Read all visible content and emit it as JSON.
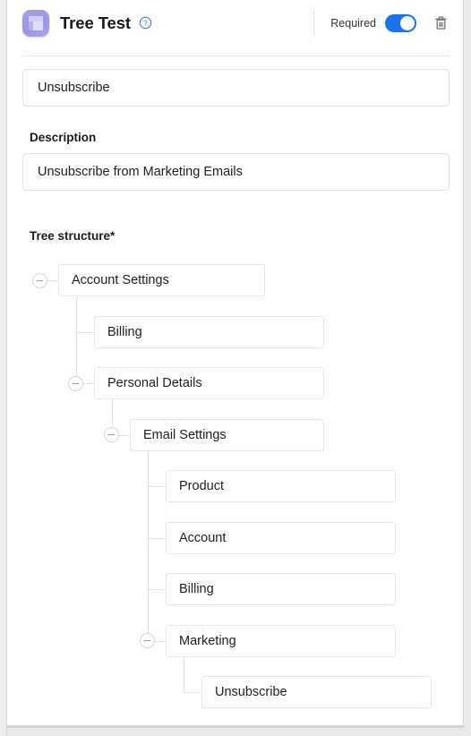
{
  "window": {
    "title": "Tree Test",
    "app_icon": "tree-test-icon",
    "help_icon": "help-circle-icon"
  },
  "header": {
    "required_label": "Required",
    "required_toggle_on": true,
    "delete_icon": "trash-icon",
    "toggle_color": "#1a73e8",
    "help_icon_color": "#3f7ae0"
  },
  "form": {
    "name": {
      "value": "Unsubscribe",
      "placeholder": "Name"
    },
    "description": {
      "label": "Description",
      "value": "Unsubscribe from Marketing Emails",
      "placeholder": "Description"
    },
    "tree_structure": {
      "label": "Tree structure*"
    }
  },
  "tree": {
    "collapse_icon": "minus-circle-icon",
    "nodes": [
      {
        "label": "Account Settings",
        "depth": 0,
        "collapsible": true
      },
      {
        "label": "Billing",
        "depth": 1,
        "collapsible": false
      },
      {
        "label": "Personal Details",
        "depth": 1,
        "collapsible": true
      },
      {
        "label": "Email Settings",
        "depth": 2,
        "collapsible": true
      },
      {
        "label": "Product",
        "depth": 3,
        "collapsible": false
      },
      {
        "label": "Account",
        "depth": 3,
        "collapsible": false
      },
      {
        "label": "Billing",
        "depth": 3,
        "collapsible": false
      },
      {
        "label": "Marketing",
        "depth": 3,
        "collapsible": true
      },
      {
        "label": "Unsubscribe",
        "depth": 4,
        "collapsible": false
      }
    ]
  }
}
